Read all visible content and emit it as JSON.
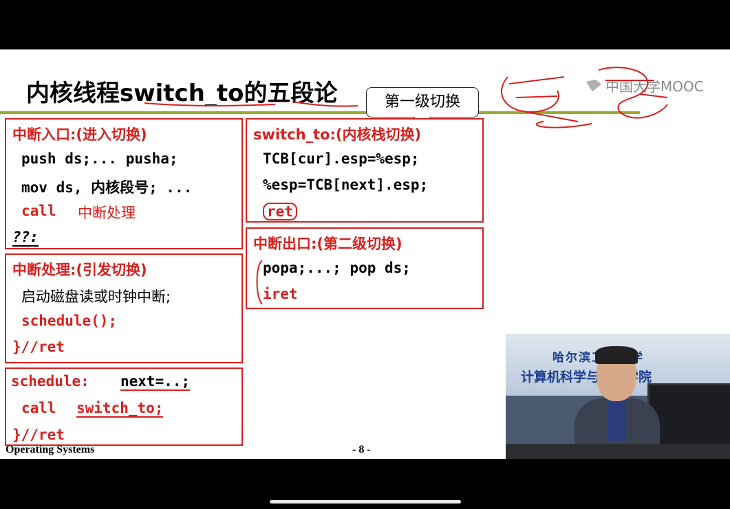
{
  "title": "内核线程switch_to的五段论",
  "brand": "中国大学MOOC",
  "callout": "第一级切换",
  "boxes": {
    "entry": {
      "header": "中断入口:(进入切换)",
      "lines": [
        "push ds;... pusha;",
        "mov ds, 内核段号; ...",
        "call",
        "中断处理",
        "??:"
      ]
    },
    "handler": {
      "header": "中断处理:(引发切换)",
      "lines": [
        "启动磁盘读或时钟中断;",
        "schedule();",
        "}//ret"
      ]
    },
    "schedule": {
      "header": "schedule:",
      "next": "next=..;",
      "call": "call",
      "switch_to": "switch_to;",
      "ret": "}//ret"
    },
    "switch_to": {
      "header": "switch_to:(内核栈切换)",
      "lines": [
        "TCB[cur].esp=%esp;",
        "%esp=TCB[next].esp;",
        "ret"
      ]
    },
    "exit": {
      "header": "中断出口:(第二级切换)",
      "lines": [
        "popa;...; pop ds;",
        "iret"
      ]
    }
  },
  "footer": {
    "left": "Operating Systems",
    "page": "- 8 -"
  },
  "video": {
    "sign_line1": "哈尔滨工业大学",
    "sign_line2": "计算机科学与技术学院"
  }
}
